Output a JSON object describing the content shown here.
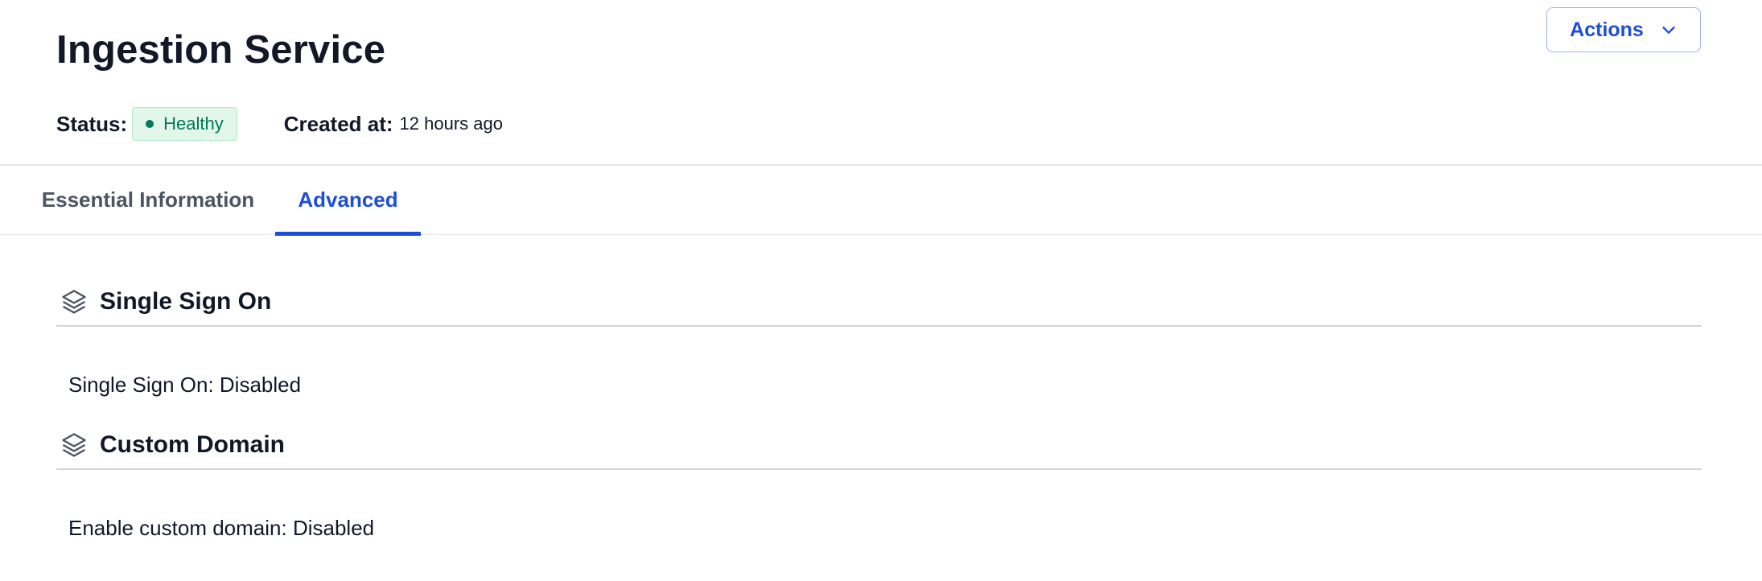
{
  "header": {
    "title": "Ingestion Service",
    "actions_label": "Actions"
  },
  "meta": {
    "status_label": "Status:",
    "status_value": "Healthy",
    "created_label": "Created at:",
    "created_value": "12 hours ago"
  },
  "tabs": [
    {
      "label": "Essential Information",
      "active": false
    },
    {
      "label": "Advanced",
      "active": true
    }
  ],
  "sections": [
    {
      "title": "Single Sign On",
      "icon": "layers-icon",
      "field_label": "Single Sign On:",
      "field_value": "Disabled"
    },
    {
      "title": "Custom Domain",
      "icon": "layers-icon",
      "field_label": "Enable custom domain:",
      "field_value": "Disabled"
    }
  ],
  "colors": {
    "accent": "#1d4ed8",
    "status_bg": "#e0f7ea",
    "status_text": "#047857"
  }
}
